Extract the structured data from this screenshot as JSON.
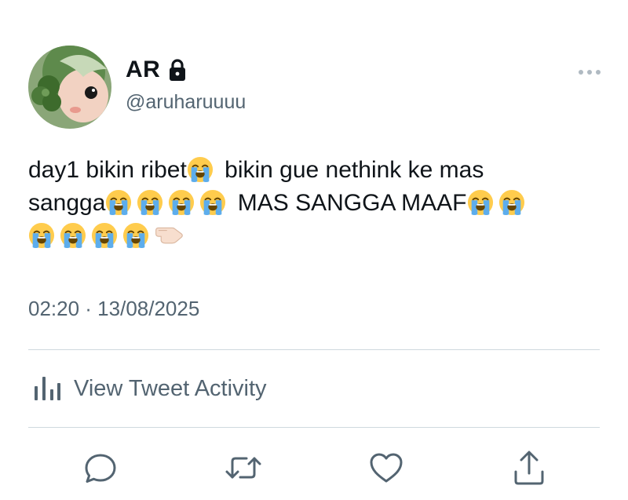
{
  "author": {
    "display_name": "AR",
    "handle": "@aruharuuuu",
    "protected_icon": "lock-icon",
    "avatar_icon": "avatar-illustration"
  },
  "tweet": {
    "line1_text_a": "day1 bikin ribet",
    "line1_text_b": " bikin gue nethink ke mas",
    "line2_text_a": "sangga",
    "line2_text_b": " MAS SANGGA MAAF",
    "emoji_primary": "loudly-crying-face",
    "emoji_last": "backhand-index-pointing-left",
    "timestamp": "02:20 · 13/08/2025"
  },
  "activity": {
    "label": "View Tweet Activity",
    "icon": "bar-chart-icon"
  },
  "actions": [
    {
      "icon": "reply-icon"
    },
    {
      "icon": "retweet-icon"
    },
    {
      "icon": "like-icon"
    },
    {
      "icon": "share-icon"
    }
  ],
  "colors": {
    "text": "#0f1419",
    "secondary": "#536471",
    "divider": "#cfd9de",
    "emoji_face": "#ffcc4d",
    "emoji_tear": "#5dadec"
  }
}
